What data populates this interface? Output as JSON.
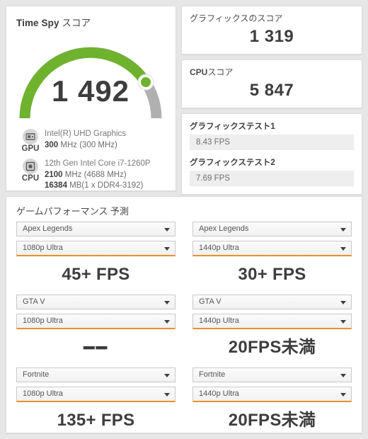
{
  "score_card": {
    "title_bold": "Time Spy",
    "title_rest": " スコア",
    "score": "1 492",
    "gauge": {
      "percent": 72,
      "fill_color": "#6fb22e",
      "track_color": "#b0b0b0"
    },
    "gpu": {
      "icon": "gpu-icon",
      "label": "GPU",
      "name": "Intel(R) UHD Graphics",
      "clock_value": "300",
      "clock_rest": " MHz (300 MHz)"
    },
    "cpu": {
      "icon": "cpu-icon",
      "label": "CPU",
      "name": "12th Gen Intel Core i7-1260P",
      "clock_value": "2100",
      "clock_rest": " MHz (4688 MHz)",
      "memory_value": "16384",
      "memory_rest": " MB(1 x DDR4-3192)"
    }
  },
  "graphics_score": {
    "title": "グラフィックスのスコア",
    "value": "1 319"
  },
  "cpu_score": {
    "title_bold": "CPU",
    "title_rest": "スコア",
    "value": "5 847"
  },
  "graphics_tests": {
    "test1": {
      "label": "グラフィックステスト1",
      "value": "8.43 FPS"
    },
    "test2": {
      "label": "グラフィックステスト2",
      "value": "7.69 FPS"
    }
  },
  "game_performance": {
    "title": "ゲームパフォーマンス 予測",
    "cells": [
      {
        "game": "Apex Legends",
        "preset": "1080p Ultra",
        "fps": "45+ FPS"
      },
      {
        "game": "Apex Legends",
        "preset": "1440p Ultra",
        "fps": "30+ FPS"
      },
      {
        "game": "GTA V",
        "preset": "1080p Ultra",
        "fps": "━━"
      },
      {
        "game": "GTA V",
        "preset": "1440p Ultra",
        "fps": "20FPS未満"
      },
      {
        "game": "Fortnite",
        "preset": "1080p Ultra",
        "fps": "135+ FPS"
      },
      {
        "game": "Fortnite",
        "preset": "1440p Ultra",
        "fps": "20FPS未満"
      }
    ]
  },
  "colors": {
    "accent_orange": "#e8912d",
    "gauge_green": "#6fb22e",
    "background": "#e6e6e6"
  }
}
